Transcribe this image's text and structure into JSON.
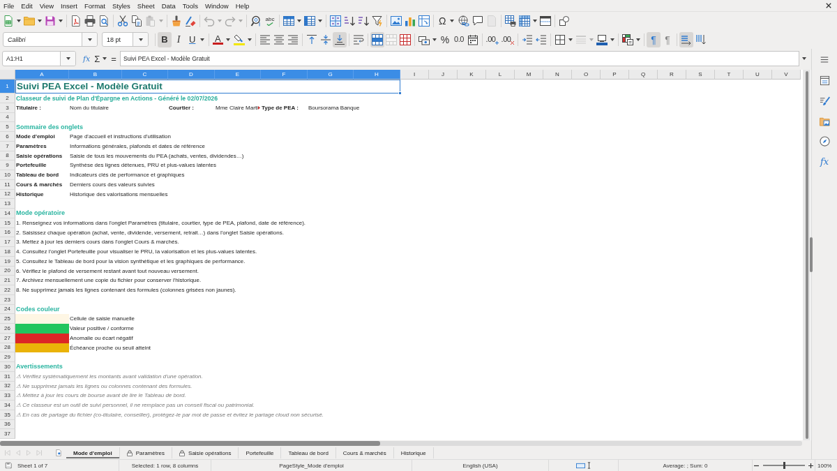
{
  "menu": [
    "File",
    "Edit",
    "View",
    "Insert",
    "Format",
    "Styles",
    "Sheet",
    "Data",
    "Tools",
    "Window",
    "Help"
  ],
  "toolbars": {
    "standard": {
      "groups": [
        [
          {
            "kind": "new-spreadsheet",
            "dropdown": true,
            "disabled": false,
            "pressed": false
          },
          {
            "kind": "open",
            "dropdown": true,
            "disabled": false,
            "pressed": false
          },
          {
            "kind": "save",
            "dropdown": true,
            "disabled": false,
            "pressed": false
          }
        ],
        [
          {
            "kind": "export-pdf",
            "dropdown": false,
            "disabled": false,
            "pressed": false
          },
          {
            "kind": "print",
            "dropdown": false,
            "disabled": false,
            "pressed": false
          },
          {
            "kind": "print-preview",
            "dropdown": false,
            "disabled": false,
            "pressed": false
          }
        ],
        [
          {
            "kind": "cut",
            "dropdown": false,
            "disabled": false,
            "pressed": false
          },
          {
            "kind": "copy",
            "dropdown": false,
            "disabled": false,
            "pressed": false
          },
          {
            "kind": "paste",
            "dropdown": true,
            "disabled": true,
            "pressed": false
          }
        ],
        [
          {
            "kind": "clone-formatting",
            "dropdown": false,
            "disabled": false,
            "pressed": false
          },
          {
            "kind": "clear-formatting",
            "dropdown": false,
            "disabled": false,
            "pressed": false
          }
        ],
        [
          {
            "kind": "undo",
            "dropdown": true,
            "disabled": true,
            "pressed": false
          },
          {
            "kind": "redo",
            "dropdown": true,
            "disabled": true,
            "pressed": false
          }
        ],
        [
          {
            "kind": "find-replace",
            "dropdown": false,
            "disabled": false,
            "pressed": false
          },
          {
            "kind": "spelling",
            "text": "abc",
            "dropdown": false,
            "disabled": false,
            "pressed": false
          }
        ],
        [
          {
            "kind": "insert-row",
            "dropdown": true,
            "disabled": false,
            "pressed": false
          },
          {
            "kind": "insert-column",
            "dropdown": true,
            "disabled": false,
            "pressed": false
          }
        ],
        [
          {
            "kind": "sort",
            "dropdown": false,
            "disabled": false,
            "pressed": false
          },
          {
            "kind": "sort-ascending",
            "dropdown": false,
            "disabled": false,
            "pressed": false
          },
          {
            "kind": "sort-descending",
            "dropdown": false,
            "disabled": false,
            "pressed": false
          },
          {
            "kind": "autofilter",
            "dropdown": false,
            "disabled": false,
            "pressed": false
          }
        ],
        [
          {
            "kind": "insert-image",
            "dropdown": false,
            "disabled": false,
            "pressed": false
          },
          {
            "kind": "insert-chart",
            "dropdown": false,
            "disabled": false,
            "pressed": false
          },
          {
            "kind": "pivot-table",
            "dropdown": false,
            "disabled": false,
            "pressed": false
          }
        ],
        [
          {
            "kind": "special-character",
            "text": "Ω",
            "dropdown": true,
            "disabled": false,
            "pressed": false
          },
          {
            "kind": "hyperlink",
            "dropdown": false,
            "disabled": false,
            "pressed": false
          },
          {
            "kind": "comment",
            "dropdown": false,
            "disabled": false,
            "pressed": false
          },
          {
            "kind": "headers-footers",
            "dropdown": false,
            "disabled": true,
            "pressed": false
          }
        ],
        [
          {
            "kind": "print-area",
            "dropdown": false,
            "disabled": false,
            "pressed": false
          },
          {
            "kind": "freeze-rows",
            "dropdown": true,
            "disabled": false,
            "pressed": false
          },
          {
            "kind": "split-window",
            "dropdown": false,
            "disabled": false,
            "pressed": false
          }
        ],
        [
          {
            "kind": "draw-functions",
            "dropdown": false,
            "disabled": false,
            "pressed": false
          }
        ]
      ]
    },
    "formatting": {
      "font_name": "Calibri",
      "font_size": "18 pt",
      "groups": [
        [
          {
            "kind": "bold",
            "text": "B",
            "dropdown": false,
            "disabled": false,
            "pressed": true
          },
          {
            "kind": "italic",
            "text": "I",
            "dropdown": false,
            "disabled": false,
            "pressed": false
          },
          {
            "kind": "underline",
            "text": "U",
            "dropdown": true,
            "disabled": false,
            "pressed": false
          }
        ],
        [
          {
            "kind": "font-color",
            "text": "A",
            "dropdown": true,
            "disabled": false,
            "pressed": false
          },
          {
            "kind": "highlight",
            "dropdown": true,
            "disabled": false,
            "pressed": false
          }
        ],
        [
          {
            "kind": "align-left",
            "dropdown": false,
            "disabled": false,
            "pressed": false
          },
          {
            "kind": "align-center",
            "dropdown": false,
            "disabled": false,
            "pressed": false
          },
          {
            "kind": "align-right",
            "dropdown": false,
            "disabled": false,
            "pressed": false
          }
        ],
        [
          {
            "kind": "align-top",
            "dropdown": false,
            "disabled": false,
            "pressed": false
          },
          {
            "kind": "align-middle",
            "dropdown": false,
            "disabled": false,
            "pressed": false
          },
          {
            "kind": "align-bottom",
            "dropdown": false,
            "disabled": false,
            "pressed": true
          }
        ],
        [
          {
            "kind": "wrap-text",
            "dropdown": false,
            "disabled": false,
            "pressed": false
          }
        ],
        [
          {
            "kind": "merge-center",
            "dropdown": false,
            "disabled": false,
            "pressed": true
          },
          {
            "kind": "merge-cells",
            "dropdown": false,
            "disabled": true,
            "pressed": false
          },
          {
            "kind": "unmerge-cells",
            "dropdown": false,
            "disabled": false,
            "pressed": false
          }
        ],
        [
          {
            "kind": "currency",
            "dropdown": true,
            "disabled": false,
            "pressed": false
          },
          {
            "kind": "percent",
            "text": "%",
            "dropdown": false,
            "disabled": false,
            "pressed": false
          },
          {
            "kind": "number-format",
            "text": "0.0",
            "dropdown": false,
            "disabled": false,
            "pressed": false
          },
          {
            "kind": "date-format",
            "dropdown": false,
            "disabled": false,
            "pressed": false
          }
        ],
        [
          {
            "kind": "add-decimal",
            "text": ".00",
            "dropdown": false,
            "disabled": false,
            "pressed": false
          },
          {
            "kind": "delete-decimal",
            "text": ".00",
            "dropdown": false,
            "disabled": false,
            "pressed": false
          }
        ],
        [
          {
            "kind": "increase-indent",
            "dropdown": false,
            "disabled": false,
            "pressed": false
          },
          {
            "kind": "decrease-indent",
            "dropdown": false,
            "disabled": false,
            "pressed": false
          }
        ],
        [
          {
            "kind": "borders",
            "dropdown": true,
            "disabled": false,
            "pressed": false
          },
          {
            "kind": "border-style",
            "dropdown": true,
            "disabled": true,
            "pressed": false
          },
          {
            "kind": "border-color",
            "dropdown": true,
            "disabled": false,
            "pressed": false
          }
        ],
        [
          {
            "kind": "conditional-format",
            "dropdown": true,
            "disabled": false,
            "pressed": false
          }
        ],
        [
          {
            "kind": "left-to-right",
            "text": "¶",
            "dropdown": false,
            "disabled": false,
            "pressed": true
          },
          {
            "kind": "right-to-left",
            "text": "¶",
            "dropdown": false,
            "disabled": false,
            "pressed": false
          }
        ],
        [
          {
            "kind": "text-horizontal",
            "dropdown": false,
            "disabled": false,
            "pressed": true
          },
          {
            "kind": "text-vertical",
            "dropdown": false,
            "disabled": false,
            "pressed": false
          }
        ]
      ]
    }
  },
  "formula_bar": {
    "name_box": "A1:H1",
    "wizard": "fx",
    "sum": "Σ",
    "equals": "=",
    "content": "Suivi PEA Excel - Modèle Gratuit"
  },
  "sidebar": {
    "items": [
      {
        "kind": "menu"
      },
      {
        "kind": "properties"
      },
      {
        "kind": "styles"
      },
      {
        "kind": "gallery"
      },
      {
        "kind": "navigator"
      },
      {
        "kind": "functions",
        "text": "fx"
      }
    ]
  },
  "sheet": {
    "columns": [
      {
        "label": "A",
        "selected": true
      },
      {
        "label": "B",
        "selected": true
      },
      {
        "label": "C",
        "selected": true
      },
      {
        "label": "D",
        "selected": true
      },
      {
        "label": "E",
        "selected": true
      },
      {
        "label": "F",
        "selected": true
      },
      {
        "label": "G",
        "selected": true
      },
      {
        "label": "H",
        "selected": true
      },
      {
        "label": "I",
        "selected": false
      },
      {
        "label": "J",
        "selected": false
      },
      {
        "label": "K",
        "selected": false
      },
      {
        "label": "L",
        "selected": false
      },
      {
        "label": "M",
        "selected": false
      },
      {
        "label": "N",
        "selected": false
      },
      {
        "label": "O",
        "selected": false
      },
      {
        "label": "P",
        "selected": false
      },
      {
        "label": "Q",
        "selected": false
      },
      {
        "label": "R",
        "selected": false
      },
      {
        "label": "S",
        "selected": false
      },
      {
        "label": "T",
        "selected": false
      },
      {
        "label": "U",
        "selected": false
      },
      {
        "label": "V",
        "selected": false
      }
    ],
    "rows": [
      {
        "number": "1",
        "selected": true,
        "kind": "title",
        "text": "Suivi PEA Excel - Modèle Gratuit"
      },
      {
        "number": "2",
        "selected": false,
        "kind": "subtitle",
        "text": "Classeur de suivi de Plan d'Épargne en Actions - Généré le 02/07/2026"
      },
      {
        "number": "3",
        "selected": false,
        "kind": "fields",
        "pairs": [
          {
            "label": "Titulaire :",
            "value": "Nom du titulaire",
            "clipped": false
          },
          {
            "label": "Courtier :",
            "value": "Mme Claire Marti",
            "clipped": true
          },
          {
            "label": "Type de PEA :",
            "value": "Boursorama Banque",
            "clipped": false
          }
        ]
      },
      {
        "number": "4",
        "selected": false,
        "kind": "empty"
      },
      {
        "number": "5",
        "selected": false,
        "kind": "heading",
        "text": "Sommaire des onglets"
      },
      {
        "number": "6",
        "selected": false,
        "kind": "entry",
        "label": "Mode d'emploi",
        "text": "Page d'accueil et instructions d'utilisation"
      },
      {
        "number": "7",
        "selected": false,
        "kind": "entry",
        "label": "Paramètres",
        "text": "Informations générales, plafonds et dates de référence"
      },
      {
        "number": "8",
        "selected": false,
        "kind": "entry",
        "label": "Saisie opérations",
        "text": "Saisie de tous les mouvements du PEA (achats, ventes, dividendes…)"
      },
      {
        "number": "9",
        "selected": false,
        "kind": "entry",
        "label": "Portefeuille",
        "text": "Synthèse des lignes détenues, PRU et plus-values latentes"
      },
      {
        "number": "10",
        "selected": false,
        "kind": "entry",
        "label": "Tableau de bord",
        "text": "Indicateurs clés de performance et graphiques"
      },
      {
        "number": "11",
        "selected": false,
        "kind": "entry",
        "label": "Cours & marchés",
        "text": "Derniers cours des valeurs suivies"
      },
      {
        "number": "12",
        "selected": false,
        "kind": "entry",
        "label": "Historique",
        "text": "Historique des valorisations mensuelles"
      },
      {
        "number": "13",
        "selected": false,
        "kind": "empty"
      },
      {
        "number": "14",
        "selected": false,
        "kind": "heading",
        "text": "Mode opératoire"
      },
      {
        "number": "15",
        "selected": false,
        "kind": "step",
        "text": "1. Renseignez vos informations dans l'onglet Paramètres (titulaire, courtier, type de PEA, plafond, date de référence)."
      },
      {
        "number": "16",
        "selected": false,
        "kind": "step",
        "text": "2. Saisissez chaque opération (achat, vente, dividende, versement, retrait…) dans l'onglet Saisie opérations."
      },
      {
        "number": "17",
        "selected": false,
        "kind": "step",
        "text": "3. Mettez à jour les derniers cours dans l'onglet Cours & marchés."
      },
      {
        "number": "18",
        "selected": false,
        "kind": "step",
        "text": "4. Consultez l'onglet Portefeuille pour visualiser le PRU, la valorisation et les plus-values latentes."
      },
      {
        "number": "19",
        "selected": false,
        "kind": "step",
        "text": "5. Consultez le Tableau de bord pour la vision synthétique et les graphiques de performance."
      },
      {
        "number": "20",
        "selected": false,
        "kind": "step",
        "text": "6. Vérifiez le plafond de versement restant avant tout nouveau versement."
      },
      {
        "number": "21",
        "selected": false,
        "kind": "step",
        "text": "7. Archivez mensuellement une copie du fichier pour conserver l'historique."
      },
      {
        "number": "22",
        "selected": false,
        "kind": "step",
        "text": "8. Ne supprimez jamais les lignes contenant des formules (colonnes grisées non jaunes)."
      },
      {
        "number": "23",
        "selected": false,
        "kind": "empty"
      },
      {
        "number": "24",
        "selected": false,
        "kind": "heading",
        "text": "Codes couleur"
      },
      {
        "number": "25",
        "selected": false,
        "kind": "swatch",
        "color": "#fef6e4",
        "text": "Cellule de saisie manuelle"
      },
      {
        "number": "26",
        "selected": false,
        "kind": "swatch",
        "color": "#22c55e",
        "text": "Valeur positive / conforme"
      },
      {
        "number": "27",
        "selected": false,
        "kind": "swatch",
        "color": "#dc2626",
        "text": "Anomalie ou écart négatif"
      },
      {
        "number": "28",
        "selected": false,
        "kind": "swatch",
        "color": "#eab308",
        "text": "Échéance proche ou seuil atteint"
      },
      {
        "number": "29",
        "selected": false,
        "kind": "empty"
      },
      {
        "number": "30",
        "selected": false,
        "kind": "heading",
        "text": "Avertissements"
      },
      {
        "number": "31",
        "selected": false,
        "kind": "warning",
        "text": "⚠ Vérifiez systématiquement les montants avant validation d'une opération."
      },
      {
        "number": "32",
        "selected": false,
        "kind": "warning",
        "text": "⚠ Ne supprimez jamais les lignes ou colonnes contenant des formules."
      },
      {
        "number": "33",
        "selected": false,
        "kind": "warning",
        "text": "⚠ Mettez à jour les cours de bourse avant de lire le Tableau de bord."
      },
      {
        "number": "34",
        "selected": false,
        "kind": "warning",
        "text": "⚠ Ce classeur est un outil de suivi personnel, il ne remplace pas un conseil fiscal ou patrimonial."
      },
      {
        "number": "35",
        "selected": false,
        "kind": "warning",
        "text": "⚠ En cas de partage du fichier (co-titulaire, conseiller), protégez-le par mot de passe et évitez le partage cloud non sécurisé."
      },
      {
        "number": "36",
        "selected": false,
        "kind": "empty"
      },
      {
        "number": "37",
        "selected": false,
        "kind": "empty"
      }
    ]
  },
  "sheet_tabs": {
    "navigation": [
      {
        "kind": "first",
        "disabled": true
      },
      {
        "kind": "previous",
        "disabled": true
      },
      {
        "kind": "next",
        "disabled": true
      },
      {
        "kind": "last",
        "disabled": true
      }
    ],
    "tabs": [
      {
        "label": "Mode d'emploi",
        "selected": true,
        "protected": false
      },
      {
        "label": "Paramètres",
        "selected": false,
        "protected": true
      },
      {
        "label": "Saisie opérations",
        "selected": false,
        "protected": true
      },
      {
        "label": "Portefeuille",
        "selected": false,
        "protected": false
      },
      {
        "label": "Tableau de bord",
        "selected": false,
        "protected": false
      },
      {
        "label": "Cours & marchés",
        "selected": false,
        "protected": false
      },
      {
        "label": "Historique",
        "selected": false,
        "protected": false
      }
    ]
  },
  "status_bar": {
    "sheet": "Sheet 1 of 7",
    "selection": "Selected: 1 row, 8 columns",
    "page_style": "PageStyle_Mode d'emploi",
    "language": "English (USA)",
    "summary": "Average: ; Sum: 0",
    "zoom": {
      "level": 0.5,
      "value": "100%"
    }
  }
}
